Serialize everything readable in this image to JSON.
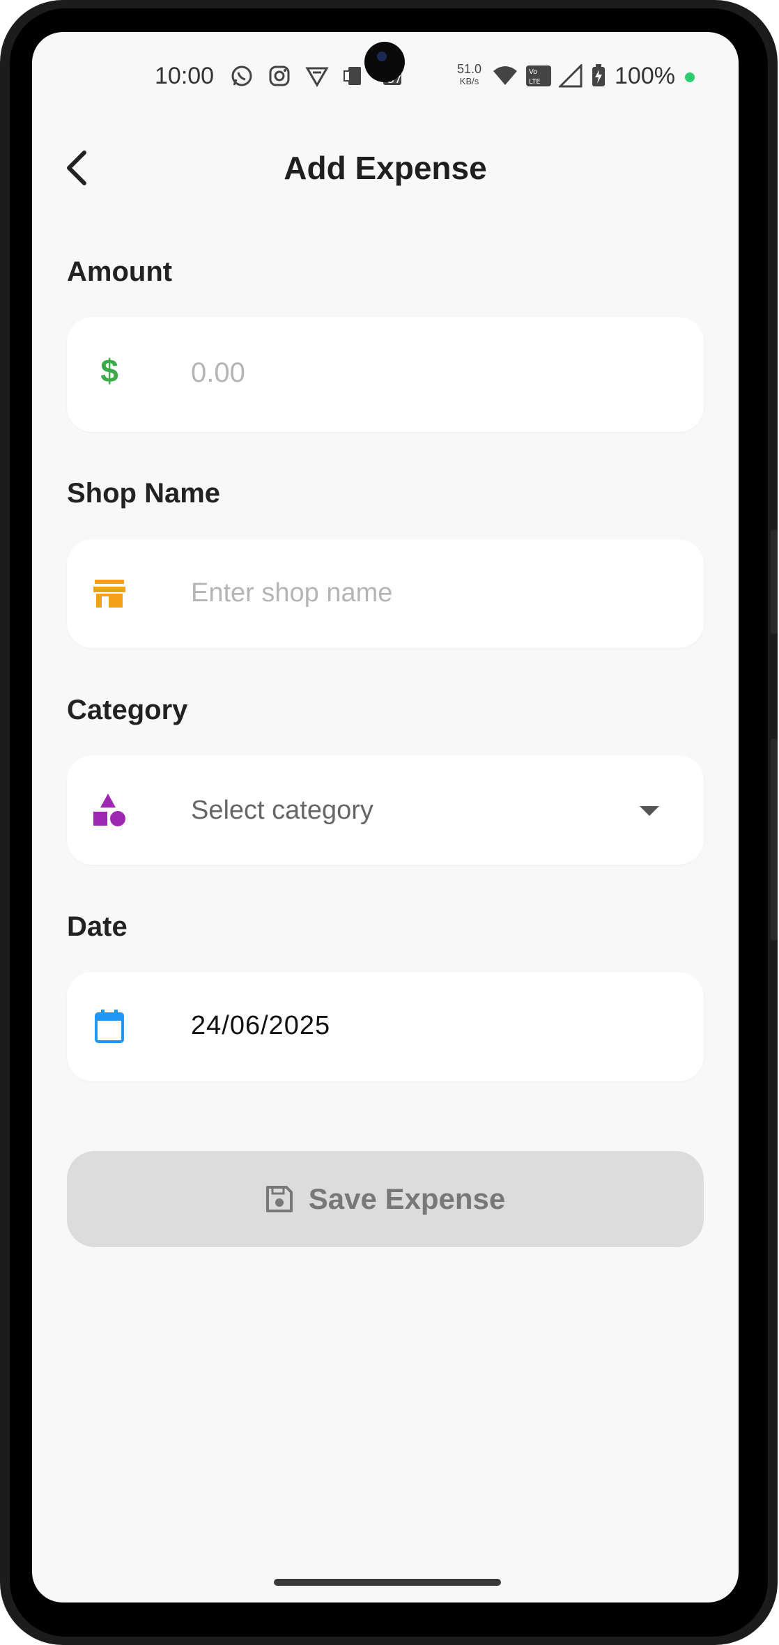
{
  "status_bar": {
    "time": "10:00",
    "net_speed_value": "51.0",
    "net_speed_unit": "KB/s",
    "volte_label": "Vo LTE",
    "battery_percent": "100%",
    "notification_icons": [
      "whatsapp-icon",
      "instagram-icon",
      "vpn-icon",
      "cast-icon",
      "calendar-badge-icon"
    ],
    "colors": {
      "active_dot": "#2ecc71"
    }
  },
  "header": {
    "title": "Add Expense",
    "back_icon": "chevron-left-icon"
  },
  "form": {
    "amount": {
      "label": "Amount",
      "prefix_symbol": "$",
      "placeholder": "0.00",
      "icon_color": "#3daa4a"
    },
    "shop": {
      "label": "Shop Name",
      "placeholder": "Enter shop name",
      "icon": "storefront-icon",
      "icon_color": "#f5a21b"
    },
    "category": {
      "label": "Category",
      "placeholder": "Select category",
      "icon": "shapes-icon",
      "icon_color": "#9c27b0"
    },
    "date": {
      "label": "Date",
      "value": "24/06/2025",
      "icon": "calendar-icon",
      "icon_color": "#2196f3"
    }
  },
  "actions": {
    "save_label": "Save Expense",
    "save_icon": "floppy-disk-icon",
    "save_enabled": false
  }
}
